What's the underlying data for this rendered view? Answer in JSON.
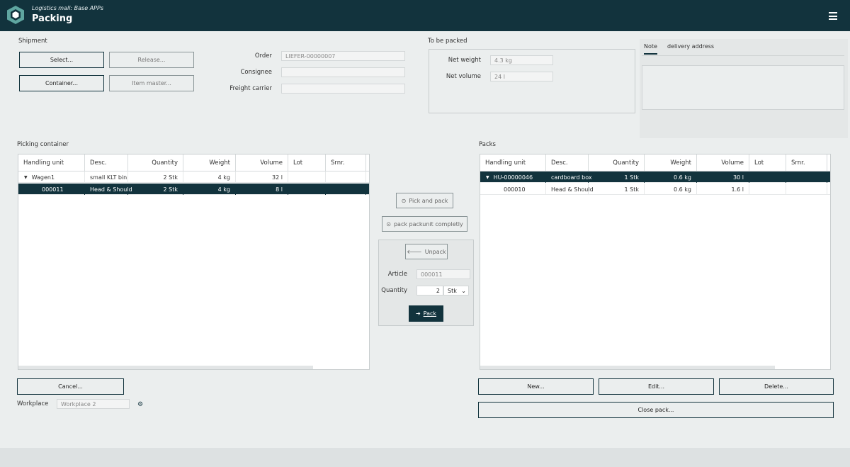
{
  "header": {
    "subtitle": "Logistics mall: Base APPs",
    "title": "Packing"
  },
  "shipment": {
    "label": "Shipment",
    "select_btn": "Select...",
    "release_btn": "Release...",
    "container_btn": "Container...",
    "item_master_btn": "Item master...",
    "order_label": "Order",
    "order_value": "LIEFER-00000007",
    "consignee_label": "Consignee",
    "consignee_value": "",
    "freight_label": "Freight carrier",
    "freight_value": ""
  },
  "to_be_packed": {
    "label": "To be packed",
    "net_weight_label": "Net weight",
    "net_weight_value": "4.3 kg",
    "net_volume_label": "Net volume",
    "net_volume_value": "24 l"
  },
  "tabs": {
    "note": "Note",
    "delivery": "delivery address"
  },
  "picking": {
    "label": "Picking container",
    "columns": [
      "Handling unit",
      "Desc.",
      "Quantity",
      "Weight",
      "Volume",
      "Lot",
      "Srnr."
    ],
    "rows": [
      {
        "hu": "Wagen1",
        "desc": "small KLT bin",
        "qty": "2 Stk",
        "weight": "4 kg",
        "volume": "32 l",
        "lot": "",
        "srnr": ""
      },
      {
        "hu": "000011",
        "desc": "Head & Should",
        "qty": "2 Stk",
        "weight": "4 kg",
        "volume": "8 l",
        "lot": "",
        "srnr": ""
      }
    ]
  },
  "packs": {
    "label": "Packs",
    "columns": [
      "Handling unit",
      "Desc.",
      "Quantity",
      "Weight",
      "Volume",
      "Lot",
      "Srnr."
    ],
    "rows": [
      {
        "hu": "HU-00000046",
        "desc": "cardboard box",
        "qty": "1 Stk",
        "weight": "0.6 kg",
        "volume": "30 l",
        "lot": "",
        "srnr": ""
      },
      {
        "hu": "000010",
        "desc": "Head & Should",
        "qty": "1 Stk",
        "weight": "0.6 kg",
        "volume": "1.6 l",
        "lot": "",
        "srnr": ""
      }
    ]
  },
  "middle": {
    "pick_and_pack": "Pick and pack",
    "pack_completely": "pack packunit completly",
    "unpack": "Unpack",
    "article_label": "Article",
    "article_value": "000011",
    "quantity_label": "Quantity",
    "quantity_value": "2",
    "unit": "Stk",
    "pack": "Pack"
  },
  "bottom": {
    "cancel": "Cancel...",
    "workplace_label": "Workplace",
    "workplace_value": "Workplace 2",
    "new": "New...",
    "edit": "Edit...",
    "delete": "Delete...",
    "close_pack": "Close pack..."
  },
  "colors": {
    "primary": "#12333d",
    "background": "#ebeeee",
    "logo": "#5fa6a0"
  }
}
